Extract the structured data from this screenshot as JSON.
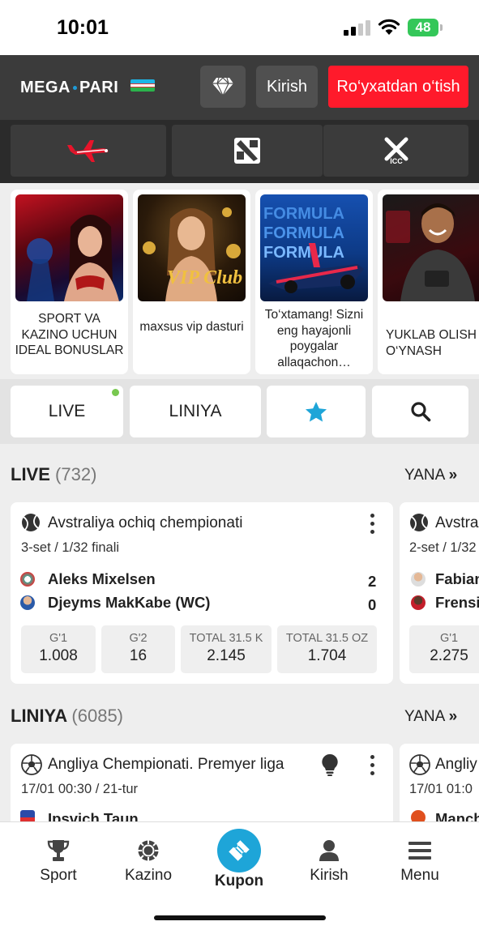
{
  "status_bar": {
    "time": "10:01",
    "battery": "48"
  },
  "header": {
    "logo": {
      "left": "MEGA",
      "right": "PARI"
    },
    "login_label": "Kirish",
    "register_label": "Ro‘yxatdan o‘tish",
    "colors": {
      "background": "#3b3b3b",
      "register": "#ff1a2b"
    }
  },
  "quick_games": [
    {
      "icon": "aviator-plane-icon"
    },
    {
      "icon": "dota2-icon"
    },
    {
      "icon": "cricket-icc-icon"
    }
  ],
  "promos": [
    {
      "text": "SPORT VA KAZINO UCHUN IDEAL BONUSLAR"
    },
    {
      "text": "maxsus vip dasturi",
      "image_text": "VIP Club"
    },
    {
      "text": "To‘xtamang! Sizni eng hayajonli poygalar allaqachon…",
      "image_text": "FORMULA"
    },
    {
      "text": "YUKLAB OLISH VA O‘YNASH"
    }
  ],
  "tabs": {
    "live": "LIVE",
    "liniya": "LINIYA"
  },
  "live_section": {
    "title": "LIVE",
    "count": "(732)",
    "more": "YANA",
    "cards": [
      {
        "tournament": "Avstraliya ochiq chempionati",
        "stage": "3-set / 1/32 finali",
        "team1": "Aleks Mixelsen",
        "team2": "Djeyms MakKabe (WC)",
        "score1": "2",
        "score2": "0",
        "odds": [
          {
            "label": "G'1",
            "value": "1.008"
          },
          {
            "label": "G'2",
            "value": "16"
          },
          {
            "label": "TOTAL 31.5 K",
            "value": "2.145"
          },
          {
            "label": "TOTAL 31.5 OZ",
            "value": "1.704"
          }
        ]
      },
      {
        "tournament": "Avstra",
        "stage": "2-set / 1/32",
        "team1": "Fabian",
        "team2": "Frensi",
        "odds": [
          {
            "label": "G'1",
            "value": "2.275"
          }
        ]
      }
    ]
  },
  "liniya_section": {
    "title": "LINIYA",
    "count": "(6085)",
    "more": "YANA",
    "cards": [
      {
        "tournament": "Angliya Chempionati. Premyer liga",
        "date": "17/01 00:30 / 21-tur",
        "team1": "Ipsvich Taun"
      },
      {
        "tournament": "Angliy",
        "date": "17/01 01:0",
        "team1": "Manch"
      }
    ]
  },
  "bottom_nav": {
    "sport": "Sport",
    "kazino": "Kazino",
    "kupon": "Kupon",
    "kirish": "Kirish",
    "menu": "Menu",
    "accent": "#1ea5d8"
  }
}
